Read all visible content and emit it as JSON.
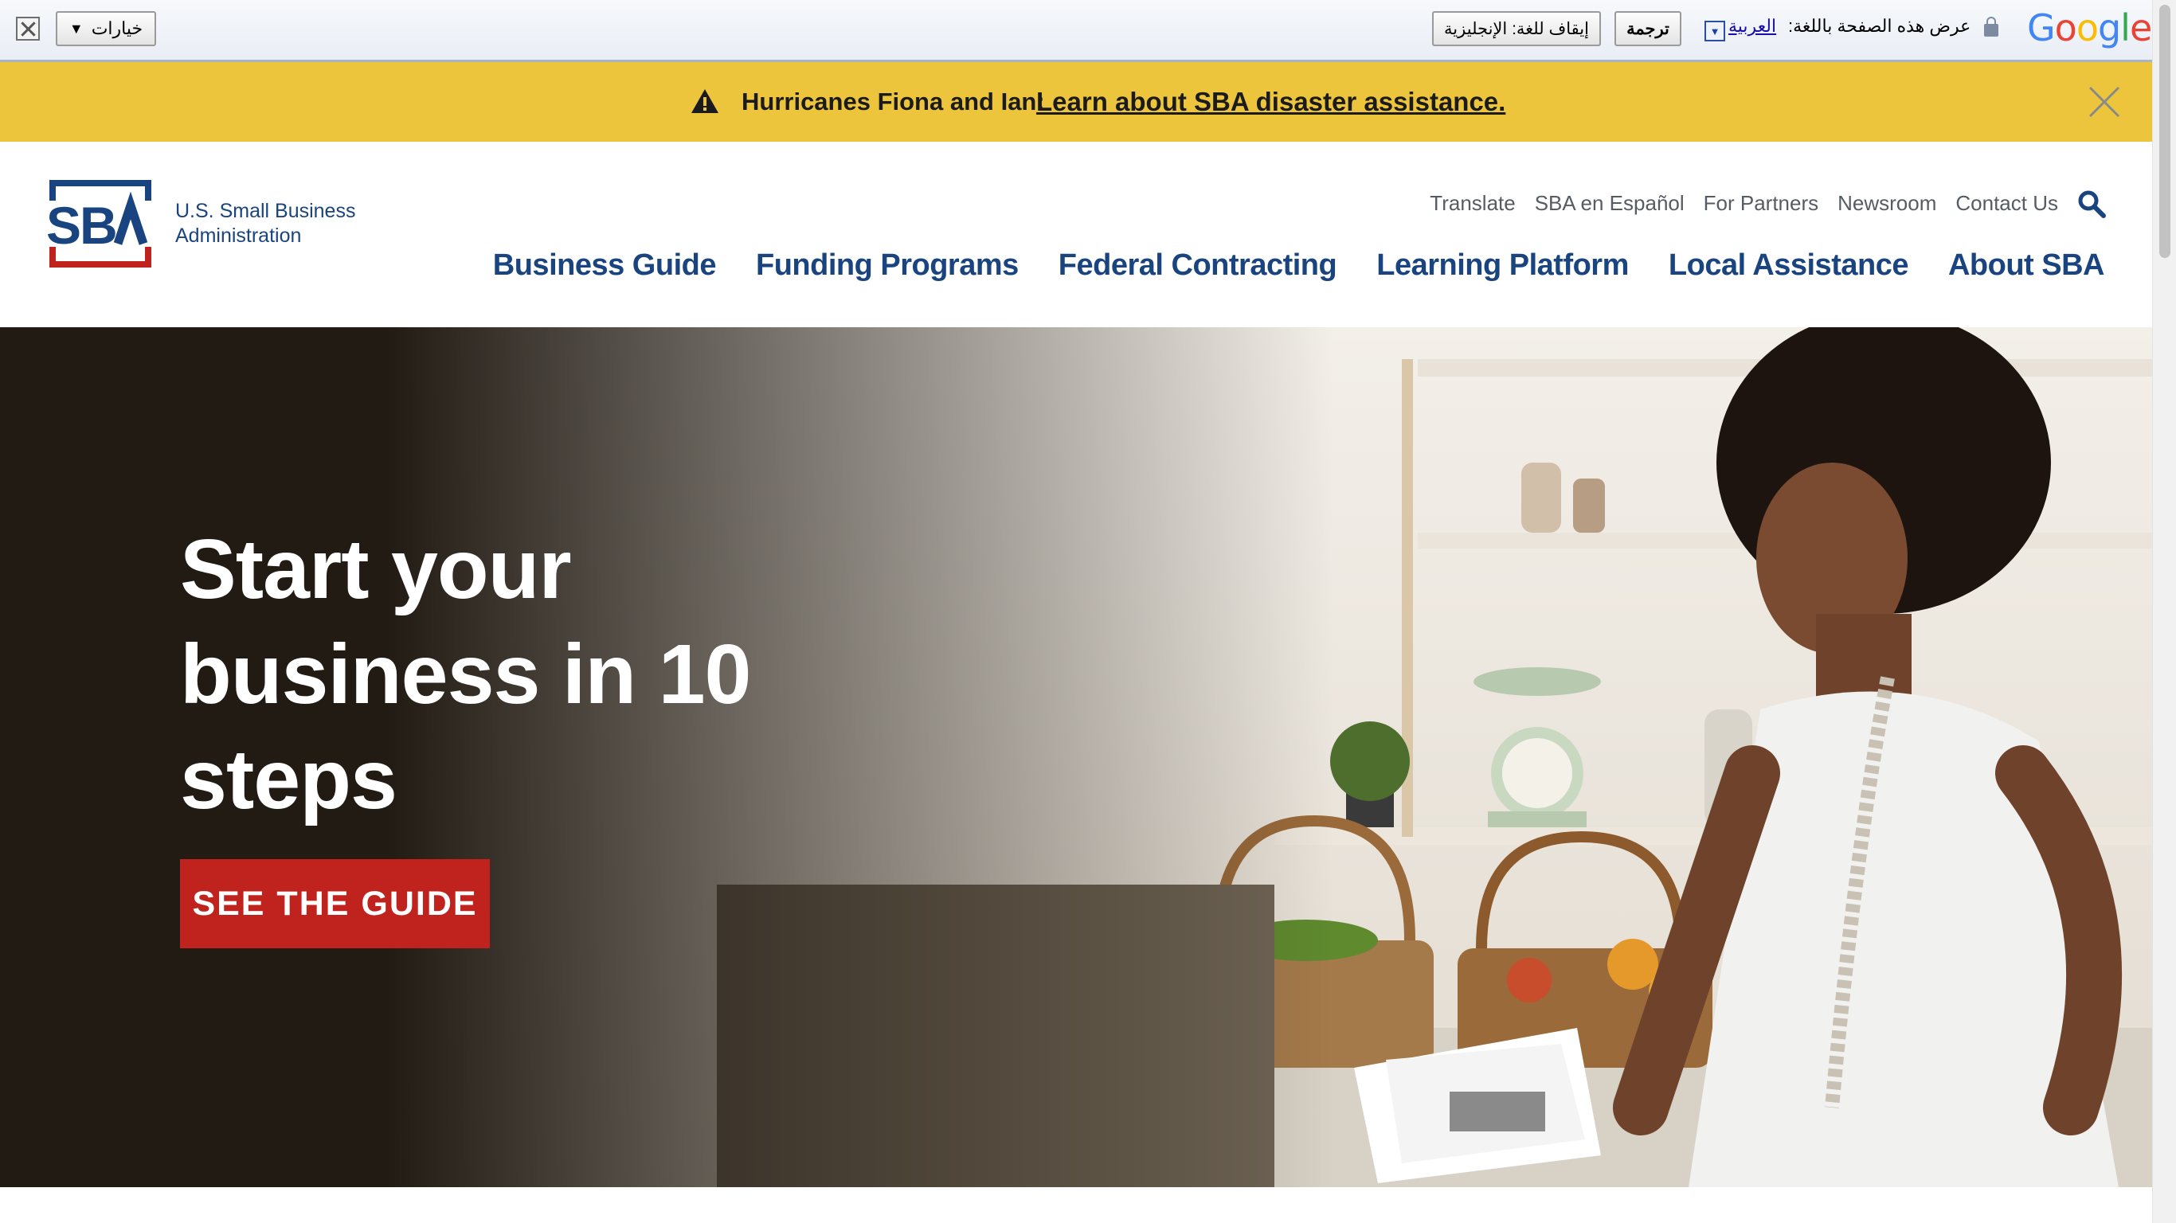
{
  "translate_bar": {
    "options_label": "خيارات",
    "options_arrow": "▼",
    "stop_label": "إيقاف للغة: الإنجليزية",
    "translate_label": "ترجمة",
    "dropdown_arrow": "▼",
    "language": "العربية",
    "prompt": "عرض هذه الصفحة باللغة:",
    "logo": [
      "G",
      "o",
      "o",
      "g",
      "l",
      "e"
    ],
    "icons": [
      "close-icon",
      "lock-icon"
    ]
  },
  "alert": {
    "label": "Hurricanes Fiona and Ian:",
    "link": "Learn about SBA disaster assistance.",
    "background": "#ecc53c",
    "icons": [
      "warning-icon",
      "close-icon"
    ]
  },
  "header": {
    "logo_line1": "U.S. Small Business",
    "logo_line2": "Administration",
    "utility_nav": [
      "Translate",
      "SBA en Español",
      "For Partners",
      "Newsroom",
      "Contact Us"
    ],
    "main_nav": [
      "Business Guide",
      "Funding Programs",
      "Federal Contracting",
      "Learning Platform",
      "Local Assistance",
      "About SBA"
    ],
    "brand_color": "#1a4480",
    "accent_color": "#c0231e",
    "icons": [
      "sba-logo",
      "search-icon"
    ]
  },
  "hero": {
    "title_line1": "Start your",
    "title_line2": "business in 10",
    "title_line3": "steps",
    "button": "SEE THE GUIDE",
    "button_color": "#c0231e"
  }
}
